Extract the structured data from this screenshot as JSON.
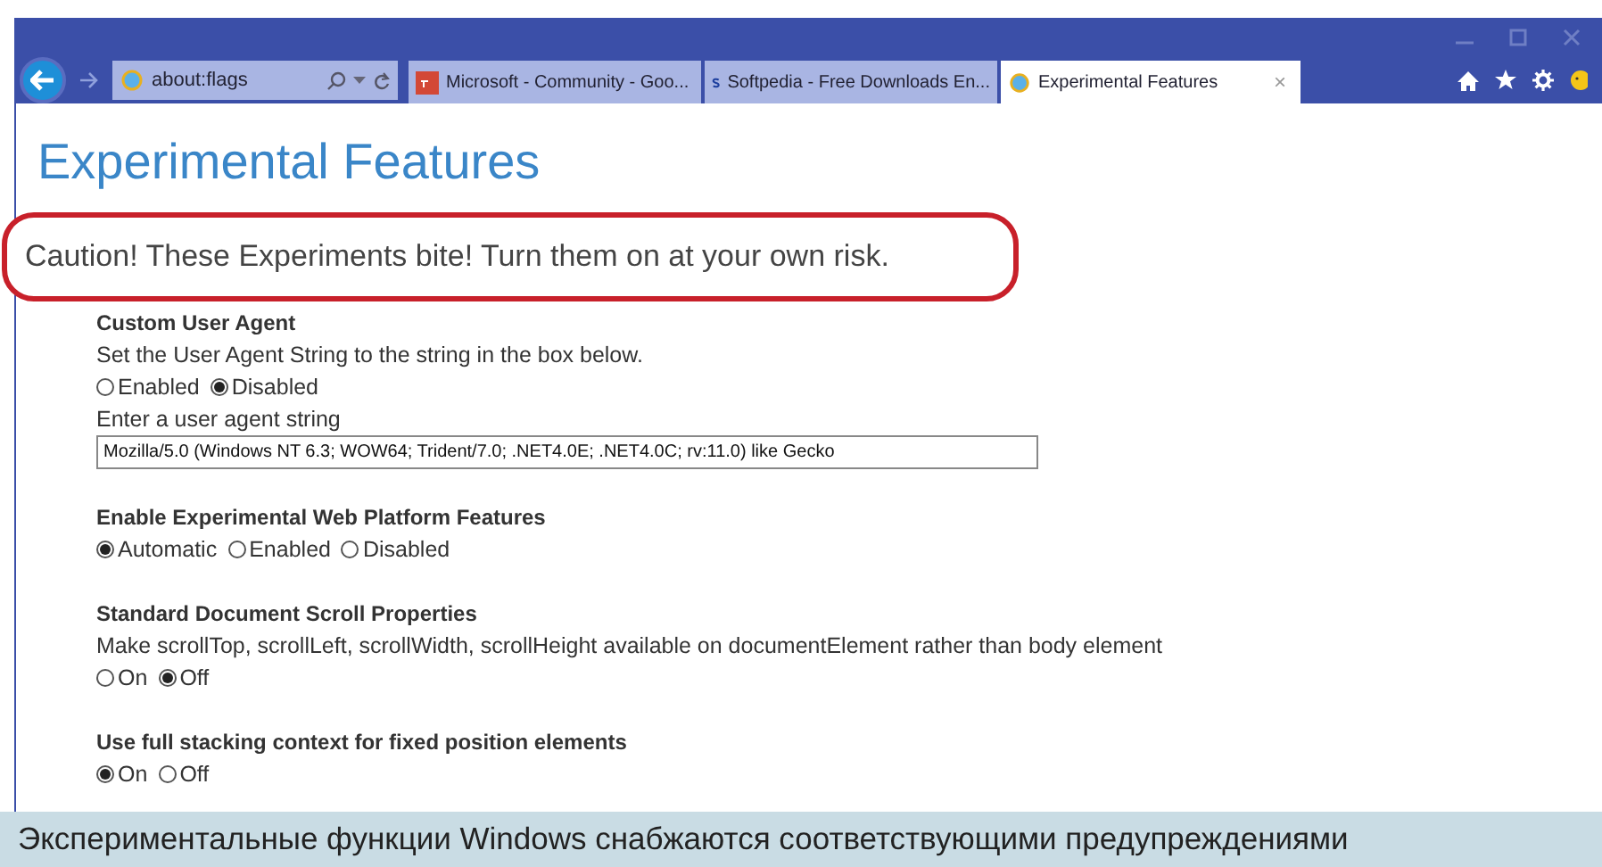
{
  "address_bar": {
    "url": "about:flags"
  },
  "tabs": [
    {
      "title": "Microsoft - Community - Goo...",
      "selected": false
    },
    {
      "title": "Softpedia - Free Downloads En...",
      "selected": false
    },
    {
      "title": "Experimental Features",
      "selected": true,
      "close": "×"
    }
  ],
  "page": {
    "title": "Experimental Features",
    "callout": "Caution! These Experiments bite! Turn them on at your own risk.",
    "sections": [
      {
        "heading": "Custom User Agent",
        "description": "Set the User Agent String to the string in the box below.",
        "options": [
          {
            "label": "Enabled",
            "selected": false
          },
          {
            "label": "Disabled",
            "selected": true
          }
        ],
        "field_label": "Enter a user agent string",
        "field_value": "Mozilla/5.0 (Windows NT 6.3; WOW64; Trident/7.0; .NET4.0E; .NET4.0C; rv:11.0) like Gecko"
      },
      {
        "heading": "Enable Experimental Web Platform Features",
        "options": [
          {
            "label": "Automatic",
            "selected": true
          },
          {
            "label": "Enabled",
            "selected": false
          },
          {
            "label": "Disabled",
            "selected": false
          }
        ]
      },
      {
        "heading": "Standard Document Scroll Properties",
        "description": "Make scrollTop, scrollLeft, scrollWidth, scrollHeight available on documentElement rather than body element",
        "options": [
          {
            "label": "On",
            "selected": false
          },
          {
            "label": "Off",
            "selected": true
          }
        ]
      },
      {
        "heading": "Use full stacking context for fixed position elements",
        "options": [
          {
            "label": "On",
            "selected": true
          },
          {
            "label": "Off",
            "selected": false
          }
        ]
      }
    ]
  },
  "caption": "Экспериментальные функции Windows снабжаются соответствующими предупреждениями"
}
